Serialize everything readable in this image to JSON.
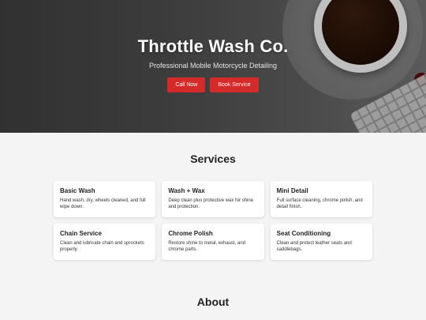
{
  "hero": {
    "title": "Throttle Wash Co.",
    "tagline": "Professional Mobile Motorcycle Detailing",
    "buttons": [
      {
        "label": "Call Now"
      },
      {
        "label": "Book Service"
      }
    ],
    "accent_color": "#d32a2a"
  },
  "services": {
    "heading": "Services",
    "items": [
      {
        "title": "Basic Wash",
        "desc": "Hand wash, dry, wheels cleaned, and full wipe down."
      },
      {
        "title": "Wash + Wax",
        "desc": "Deep clean plus protective wax for shine and protection."
      },
      {
        "title": "Mini Detail",
        "desc": "Full surface cleaning, chrome polish, and detail finish."
      },
      {
        "title": "Chain Service",
        "desc": "Clean and lubricate chain and sprockets properly."
      },
      {
        "title": "Chrome Polish",
        "desc": "Restore shine to metal, exhaust, and chrome parts."
      },
      {
        "title": "Seat Conditioning",
        "desc": "Clean and protect leather seats and saddlebags."
      }
    ]
  },
  "about": {
    "heading": "About"
  }
}
